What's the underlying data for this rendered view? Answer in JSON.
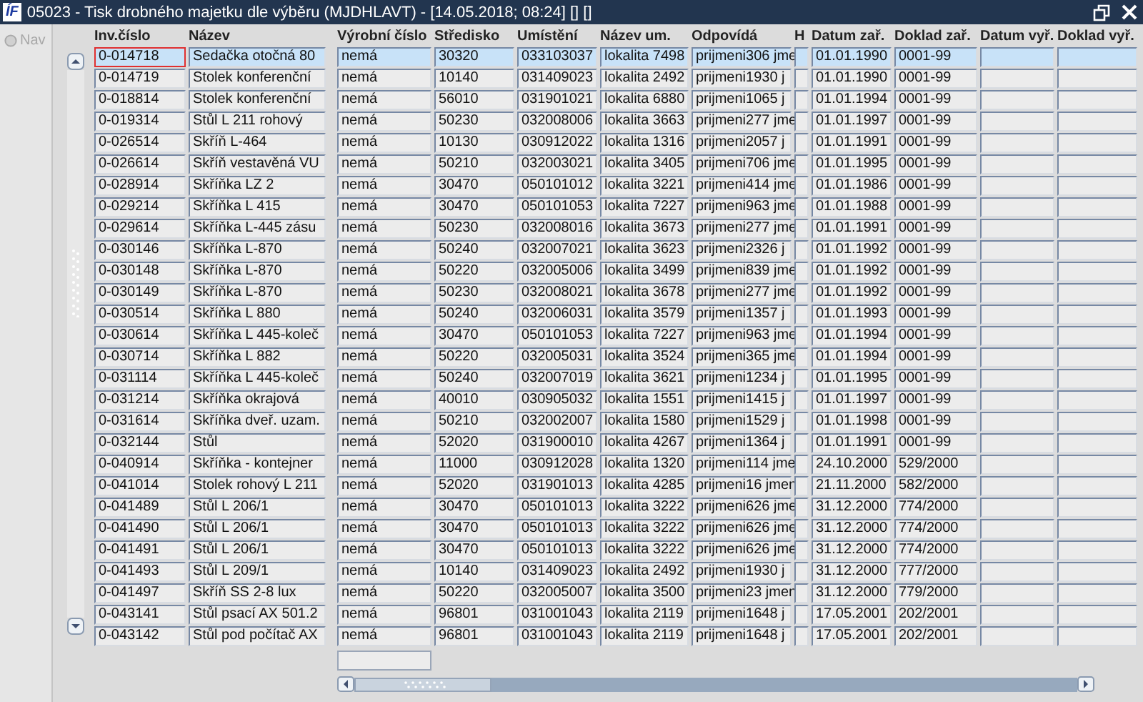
{
  "window": {
    "logo": "ÍF",
    "title": "05023 - Tisk drobného majetku dle výběru (MJDHLAVT) - [14.05.2018; 08:24] [] []"
  },
  "nav": {
    "label": "Nav",
    "disabled": true
  },
  "table": {
    "columns": [
      {
        "label": "Inv.číslo",
        "kind": "text"
      },
      {
        "label": "Název",
        "kind": "text"
      },
      {
        "label": "Výrobní číslo",
        "kind": "text"
      },
      {
        "label": "Středisko",
        "kind": "text"
      },
      {
        "label": "Umístění",
        "kind": "text"
      },
      {
        "label": "Název um.",
        "kind": "text"
      },
      {
        "label": "Odpovídá",
        "kind": "text"
      },
      {
        "label": "H",
        "kind": "flag"
      },
      {
        "label": "Datum zař.",
        "kind": "text"
      },
      {
        "label": "Doklad zař.",
        "kind": "text"
      },
      {
        "label": "Datum vyř.",
        "kind": "text"
      },
      {
        "label": "Doklad vyř.",
        "kind": "text"
      }
    ],
    "rows": [
      {
        "selected": true,
        "cells": [
          "0-014718",
          "Sedačka otočná 80",
          "nemá",
          "30320",
          "033103037",
          "lokalita 7498",
          "prijmeni306 jme",
          "",
          "01.01.1990",
          "0001-99",
          "",
          ""
        ]
      },
      {
        "selected": false,
        "cells": [
          "0-014719",
          "Stolek konferenční",
          "nemá",
          "10140",
          "031409023",
          "lokalita 2492",
          "prijmeni1930 j",
          "",
          "01.01.1990",
          "0001-99",
          "",
          ""
        ]
      },
      {
        "selected": false,
        "cells": [
          "0-018814",
          "Stolek konferenční",
          "nemá",
          "56010",
          "031901021",
          "lokalita 6880",
          "prijmeni1065 j",
          "",
          "01.01.1994",
          "0001-99",
          "",
          ""
        ]
      },
      {
        "selected": false,
        "cells": [
          "0-019314",
          "Stůl L 211 rohový",
          "nemá",
          "50230",
          "032008006",
          "lokalita 3663",
          "prijmeni277 jme",
          "",
          "01.01.1997",
          "0001-99",
          "",
          ""
        ]
      },
      {
        "selected": false,
        "cells": [
          "0-026514",
          "Skříň L-464",
          "nemá",
          "10130",
          "030912022",
          "lokalita 1316",
          "prijmeni2057 j",
          "",
          "01.01.1991",
          "0001-99",
          "",
          ""
        ]
      },
      {
        "selected": false,
        "cells": [
          "0-026614",
          "Skříň vestavěná VU",
          "nemá",
          "50210",
          "032003021",
          "lokalita 3405",
          "prijmeni706 jme",
          "",
          "01.01.1995",
          "0001-99",
          "",
          ""
        ]
      },
      {
        "selected": false,
        "cells": [
          "0-028914",
          "Skříňka LZ 2",
          "nemá",
          "30470",
          "050101012",
          "lokalita 3221",
          "prijmeni414 jme",
          "",
          "01.01.1986",
          "0001-99",
          "",
          ""
        ]
      },
      {
        "selected": false,
        "cells": [
          "0-029214",
          "Skříňka L 415",
          "nemá",
          "30470",
          "050101053",
          "lokalita 7227",
          "prijmeni963 jme",
          "",
          "01.01.1988",
          "0001-99",
          "",
          ""
        ]
      },
      {
        "selected": false,
        "cells": [
          "0-029614",
          "Skříňka L-445 zásu",
          "nemá",
          "50230",
          "032008016",
          "lokalita 3673",
          "prijmeni277 jme",
          "",
          "01.01.1991",
          "0001-99",
          "",
          ""
        ]
      },
      {
        "selected": false,
        "cells": [
          "0-030146",
          "Skříňka L-870",
          "nemá",
          "50240",
          "032007021",
          "lokalita 3623",
          "prijmeni2326 j",
          "",
          "01.01.1992",
          "0001-99",
          "",
          ""
        ]
      },
      {
        "selected": false,
        "cells": [
          "0-030148",
          "Skříňka L-870",
          "nemá",
          "50220",
          "032005006",
          "lokalita 3499",
          "prijmeni839 jme",
          "",
          "01.01.1992",
          "0001-99",
          "",
          ""
        ]
      },
      {
        "selected": false,
        "cells": [
          "0-030149",
          "Skříňka L-870",
          "nemá",
          "50230",
          "032008021",
          "lokalita 3678",
          "prijmeni277 jme",
          "",
          "01.01.1992",
          "0001-99",
          "",
          ""
        ]
      },
      {
        "selected": false,
        "cells": [
          "0-030514",
          "Skříňka L 880",
          "nemá",
          "50240",
          "032006031",
          "lokalita 3579",
          "prijmeni1357 j",
          "",
          "01.01.1993",
          "0001-99",
          "",
          ""
        ]
      },
      {
        "selected": false,
        "cells": [
          "0-030614",
          "Skříňka L 445-koleč",
          "nemá",
          "30470",
          "050101053",
          "lokalita 7227",
          "prijmeni963 jme",
          "",
          "01.01.1994",
          "0001-99",
          "",
          ""
        ]
      },
      {
        "selected": false,
        "cells": [
          "0-030714",
          "Skříňka L 882",
          "nemá",
          "50220",
          "032005031",
          "lokalita 3524",
          "prijmeni365 jme",
          "",
          "01.01.1994",
          "0001-99",
          "",
          ""
        ]
      },
      {
        "selected": false,
        "cells": [
          "0-031114",
          "Skříňka L 445-koleč",
          "nemá",
          "50240",
          "032007019",
          "lokalita 3621",
          "prijmeni1234 j",
          "",
          "01.01.1995",
          "0001-99",
          "",
          ""
        ]
      },
      {
        "selected": false,
        "cells": [
          "0-031214",
          "Skříňka okrajová",
          "nemá",
          "40010",
          "030905032",
          "lokalita 1551",
          "prijmeni1415 j",
          "",
          "01.01.1997",
          "0001-99",
          "",
          ""
        ]
      },
      {
        "selected": false,
        "cells": [
          "0-031614",
          "Skříňka dveř. uzam.",
          "nemá",
          "50210",
          "032002007",
          "lokalita 1580",
          "prijmeni1529 j",
          "",
          "01.01.1998",
          "0001-99",
          "",
          ""
        ]
      },
      {
        "selected": false,
        "cells": [
          "0-032144",
          "Stůl",
          "nemá",
          "52020",
          "031900010",
          "lokalita 4267",
          "prijmeni1364 j",
          "",
          "01.01.1991",
          "0001-99",
          "",
          ""
        ]
      },
      {
        "selected": false,
        "cells": [
          "0-040914",
          "Skříňka - kontejner",
          "nemá",
          "11000",
          "030912028",
          "lokalita 1320",
          "prijmeni114 jme",
          "",
          "24.10.2000",
          "529/2000",
          "",
          ""
        ]
      },
      {
        "selected": false,
        "cells": [
          "0-041014",
          "Stolek rohový L 211",
          "nemá",
          "52020",
          "031901013",
          "lokalita 4285",
          "prijmeni16 jmen",
          "",
          "21.11.2000",
          "582/2000",
          "",
          ""
        ]
      },
      {
        "selected": false,
        "cells": [
          "0-041489",
          "Stůl L 206/1",
          "nemá",
          "30470",
          "050101013",
          "lokalita 3222",
          "prijmeni626 jme",
          "",
          "31.12.2000",
          "774/2000",
          "",
          ""
        ]
      },
      {
        "selected": false,
        "cells": [
          "0-041490",
          "Stůl L 206/1",
          "nemá",
          "30470",
          "050101013",
          "lokalita 3222",
          "prijmeni626 jme",
          "",
          "31.12.2000",
          "774/2000",
          "",
          ""
        ]
      },
      {
        "selected": false,
        "cells": [
          "0-041491",
          "Stůl L 206/1",
          "nemá",
          "30470",
          "050101013",
          "lokalita 3222",
          "prijmeni626 jme",
          "",
          "31.12.2000",
          "774/2000",
          "",
          ""
        ]
      },
      {
        "selected": false,
        "cells": [
          "0-041493",
          "Stůl L 209/1",
          "nemá",
          "10140",
          "031409023",
          "lokalita 2492",
          "prijmeni1930 j",
          "",
          "31.12.2000",
          "777/2000",
          "",
          ""
        ]
      },
      {
        "selected": false,
        "cells": [
          "0-041497",
          "Skříň SS 2-8 lux",
          "nemá",
          "50220",
          "032005007",
          "lokalita 3500",
          "prijmeni23 jmen",
          "",
          "31.12.2000",
          "779/2000",
          "",
          ""
        ]
      },
      {
        "selected": false,
        "cells": [
          "0-043141",
          "Stůl psací AX 501.2",
          "nemá",
          "96801",
          "031001043",
          "lokalita 2119",
          "prijmeni1648 j",
          "",
          "17.05.2001",
          "202/2001",
          "",
          ""
        ]
      },
      {
        "selected": false,
        "cells": [
          "0-043142",
          "Stůl pod počítač AX",
          "nemá",
          "96801",
          "031001043",
          "lokalita 2119",
          "prijmeni1648 j",
          "",
          "17.05.2001",
          "202/2001",
          "",
          ""
        ]
      }
    ]
  }
}
